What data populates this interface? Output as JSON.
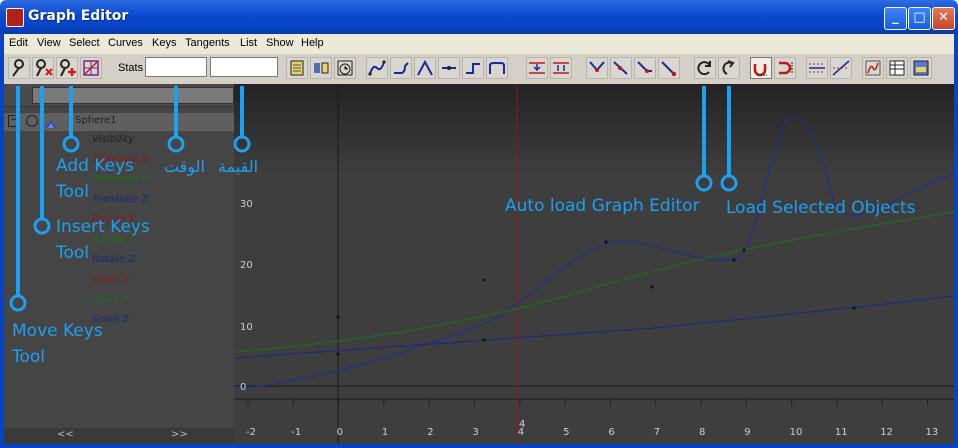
{
  "window": {
    "title": "Graph Editor",
    "buttons": {
      "minimize": "_",
      "maximize": "□",
      "close": "✕"
    }
  },
  "menu": [
    "Edit",
    "View",
    "Select",
    "Curves",
    "Keys",
    "Tangents",
    "List",
    "Show",
    "Help"
  ],
  "toolbar": {
    "stats_label": "Stats",
    "time_field": "",
    "value_field": ""
  },
  "outliner": {
    "node": "Sphere1",
    "attributes": [
      {
        "name": "Visibility",
        "color": "#202020"
      },
      {
        "name": "Translate X",
        "color": "#8b1a1a"
      },
      {
        "name": "Translate Y",
        "color": "#1d6e1d"
      },
      {
        "name": "Translate Z",
        "color": "#1a2a7a"
      },
      {
        "name": "Rotate X",
        "color": "#8b1a1a"
      },
      {
        "name": "Rotate Y",
        "color": "#1d6e1d"
      },
      {
        "name": "Rotate Z",
        "color": "#1a2a7a"
      },
      {
        "name": "Scale X",
        "color": "#8b1a1a"
      },
      {
        "name": "Scale Y",
        "color": "#1d6e1d"
      },
      {
        "name": "Scale Z",
        "color": "#1a2a7a"
      }
    ],
    "scroll_left": "<<",
    "scroll_right": ">>"
  },
  "graph": {
    "current_frame_label": "4",
    "x_ticks": [
      "-2",
      "-1",
      "0",
      "1",
      "2",
      "3",
      "4",
      "5",
      "6",
      "7",
      "8",
      "9",
      "10",
      "11",
      "12",
      "13"
    ],
    "y_ticks": [
      "30",
      "20",
      "10",
      "0"
    ],
    "colors": {
      "red_curve": "#262c8c",
      "green_curve": "#1f6a1f",
      "blue_curve": "#22287c",
      "time_marker": "#8a1a1a"
    }
  },
  "annotations": {
    "move_keys": "Move Keys\nTool",
    "insert_keys": "Insert Keys\nTool",
    "add_keys": "Add Keys\nTool",
    "time": "الوقت",
    "value": "القيمة",
    "auto_load": "Auto load Graph Editor",
    "load_selected": "Load Selected Objects",
    "color": "#1ea0f0"
  }
}
